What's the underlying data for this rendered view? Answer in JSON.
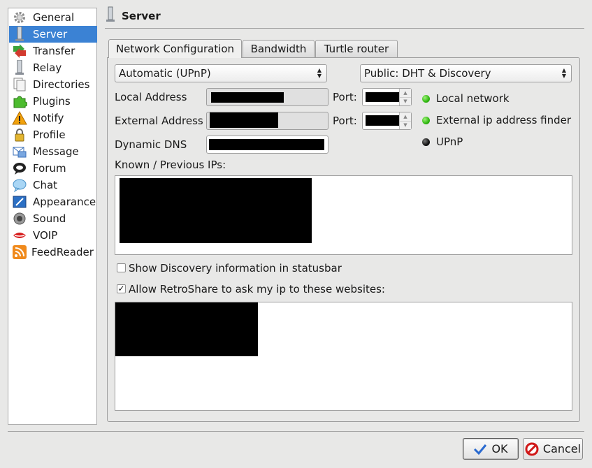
{
  "sidebar": {
    "items": [
      {
        "label": "General",
        "icon": "gear-icon"
      },
      {
        "label": "Server",
        "icon": "server-icon"
      },
      {
        "label": "Transfer",
        "icon": "transfer-icon"
      },
      {
        "label": "Relay",
        "icon": "relay-icon"
      },
      {
        "label": "Directories",
        "icon": "directories-icon"
      },
      {
        "label": "Plugins",
        "icon": "puzzle-icon"
      },
      {
        "label": "Notify",
        "icon": "warning-icon"
      },
      {
        "label": "Profile",
        "icon": "lock-icon"
      },
      {
        "label": "Message",
        "icon": "message-icon"
      },
      {
        "label": "Forum",
        "icon": "forum-icon"
      },
      {
        "label": "Chat",
        "icon": "chat-bubble-icon"
      },
      {
        "label": "Appearance",
        "icon": "appearance-icon"
      },
      {
        "label": "Sound",
        "icon": "speaker-icon"
      },
      {
        "label": "VOIP",
        "icon": "lips-icon"
      },
      {
        "label": "FeedReader",
        "icon": "rss-icon"
      }
    ],
    "selected": "Server"
  },
  "header": {
    "title": "Server",
    "icon": "server-icon"
  },
  "tabs": [
    {
      "label": "Network Configuration",
      "active": true
    },
    {
      "label": "Bandwidth",
      "active": false
    },
    {
      "label": "Turtle router",
      "active": false
    }
  ],
  "network": {
    "nat_mode": "Automatic (UPnP)",
    "discovery_mode": "Public: DHT & Discovery",
    "local_address_label": "Local Address",
    "external_address_label": "External Address",
    "dynamic_dns_label": "Dynamic DNS",
    "port_label": "Port:",
    "known_ips_label": "Known / Previous IPs:",
    "status": [
      {
        "label": "Local network",
        "state": "ok",
        "color": "#2fb80f"
      },
      {
        "label": "External ip address finder",
        "state": "ok",
        "color": "#2fb80f"
      },
      {
        "label": "UPnP",
        "state": "off",
        "color": "#111111"
      }
    ],
    "show_discovery_label": "Show Discovery information in statusbar",
    "show_discovery_checked": false,
    "allow_ip_label": "Allow RetroShare to ask my ip to these websites:",
    "allow_ip_checked": true
  },
  "buttons": {
    "ok": "OK",
    "cancel": "Cancel"
  },
  "colors": {
    "selection": "#3b82d4",
    "ok_icon": "#2a6ad0",
    "cancel_icon": "#d01818"
  }
}
